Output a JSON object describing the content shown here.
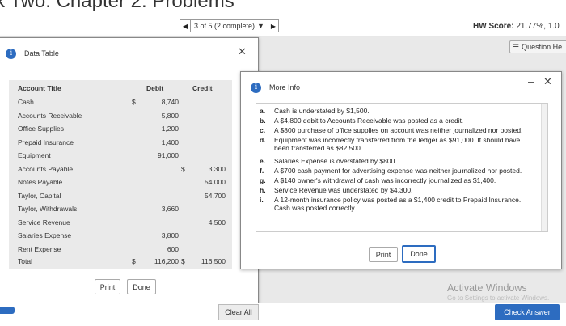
{
  "header": {
    "page_title": "k Two: Chapter 2: Problems",
    "pager_text": "3 of 5 (2 complete)",
    "hw_score_label": "HW Score:",
    "hw_score_value": "21.77%, 1.0",
    "question_help": "Question He"
  },
  "data_table": {
    "title": "Data Table",
    "columns": [
      "Account Title",
      "Debit",
      "Credit"
    ],
    "rows": [
      {
        "account": "Cash",
        "debit_sym": "$",
        "debit": "8,740",
        "credit_sym": "",
        "credit": ""
      },
      {
        "account": "Accounts Receivable",
        "debit_sym": "",
        "debit": "5,800",
        "credit_sym": "",
        "credit": ""
      },
      {
        "account": "Office Supplies",
        "debit_sym": "",
        "debit": "1,200",
        "credit_sym": "",
        "credit": ""
      },
      {
        "account": "Prepaid Insurance",
        "debit_sym": "",
        "debit": "1,400",
        "credit_sym": "",
        "credit": ""
      },
      {
        "account": "Equipment",
        "debit_sym": "",
        "debit": "91,000",
        "credit_sym": "",
        "credit": ""
      },
      {
        "account": "Accounts Payable",
        "debit_sym": "",
        "debit": "",
        "credit_sym": "$",
        "credit": "3,300"
      },
      {
        "account": "Notes Payable",
        "debit_sym": "",
        "debit": "",
        "credit_sym": "",
        "credit": "54,000"
      },
      {
        "account": "Taylor, Capital",
        "debit_sym": "",
        "debit": "",
        "credit_sym": "",
        "credit": "54,700"
      },
      {
        "account": "Taylor, Withdrawals",
        "debit_sym": "",
        "debit": "3,660",
        "credit_sym": "",
        "credit": ""
      },
      {
        "account": "Service Revenue",
        "debit_sym": "",
        "debit": "",
        "credit_sym": "",
        "credit": "4,500"
      },
      {
        "account": "Salaries Expense",
        "debit_sym": "",
        "debit": "3,800",
        "credit_sym": "",
        "credit": ""
      },
      {
        "account": "Rent Expense",
        "debit_sym": "",
        "debit": "600",
        "credit_sym": "",
        "credit": ""
      }
    ],
    "total": {
      "label": "Total",
      "debit_sym": "$",
      "debit": "116,200",
      "credit_sym": "$",
      "credit": "116,500"
    },
    "print": "Print",
    "done": "Done"
  },
  "more_info": {
    "title": "More Info",
    "items": [
      {
        "letter": "a.",
        "text": "Cash is understated by $1,500."
      },
      {
        "letter": "b.",
        "text": "A $4,800 debit to Accounts Receivable was posted as a credit."
      },
      {
        "letter": "c.",
        "text": "A $800 purchase of office supplies on account was neither journalized nor posted."
      },
      {
        "letter": "d.",
        "text": "Equipment was incorrectly transferred from the ledger as $91,000. It should have been transferred as $82,500."
      },
      {
        "letter": "e.",
        "text": "Salaries Expense is overstated by $800."
      },
      {
        "letter": "f.",
        "text": "A $700 cash payment for advertising expense was neither journalized nor posted."
      },
      {
        "letter": "g.",
        "text": "A $140 owner's withdrawal of cash was incorrectly journalized as $1,400."
      },
      {
        "letter": "h.",
        "text": "Service Revenue was understated by $4,300."
      },
      {
        "letter": "i.",
        "text": "A 12-month insurance policy was posted as a $1,400 credit to Prepaid Insurance. Cash was posted correctly."
      }
    ],
    "print": "Print",
    "done": "Done"
  },
  "footer": {
    "clear_all": "Clear All",
    "check_answer": "Check Answer",
    "activate_title": "Activate Windows",
    "activate_sub": "Go to Settings to activate Windows."
  },
  "colors": {
    "accent": "#2d6cc0"
  }
}
